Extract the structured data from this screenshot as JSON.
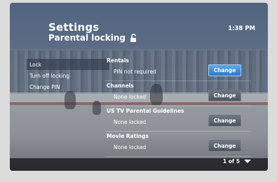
{
  "header": {
    "title": "Settings",
    "subtitle": "Parental locking",
    "clock": "1:38 PM",
    "icon": "lock-open-icon"
  },
  "menu": {
    "items": [
      {
        "label": "Lock"
      },
      {
        "label": "Turn off locking"
      },
      {
        "label": "Change PIN"
      }
    ]
  },
  "sections": [
    {
      "title": "Rentals",
      "value": "PIN not required",
      "button": "Change"
    },
    {
      "title": "Channels",
      "value": "None locked",
      "button": "Change"
    },
    {
      "title": "US TV Parental Guidelines",
      "value": "None locked",
      "button": "Change"
    },
    {
      "title": "Movie Ratings",
      "value": "None locked",
      "button": "Change"
    }
  ],
  "pager": {
    "label": "1 of 5",
    "icon": "chevron-down-icon"
  },
  "colors": {
    "focus": "#3a86d6",
    "button": "#59616d"
  }
}
